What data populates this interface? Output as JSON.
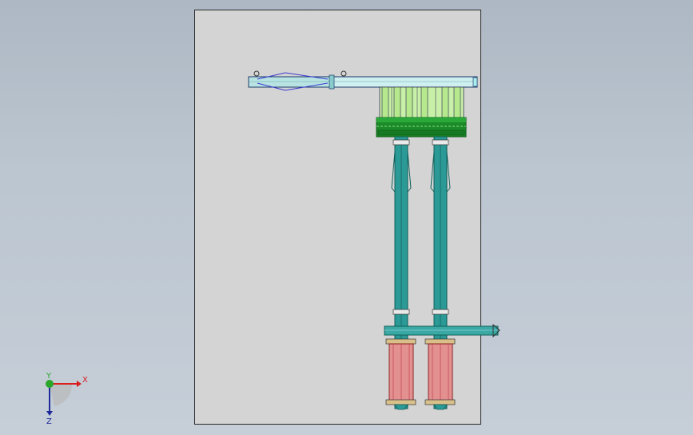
{
  "viewport": {
    "background": "#b6c0cb",
    "sheet_color": "#d4d4d4"
  },
  "model": {
    "colors": {
      "beam": "#cfeff0",
      "beam_left": "#b9e3e3",
      "outline": "#1a3a6a",
      "columns": "#c8f0a8",
      "plate": "#1d8a2a",
      "plate_dark": "#0d5a18",
      "legs": "#2b9a96",
      "legs_dark": "#0f5f5a",
      "crossbar": "#3aa9a3",
      "cylinders": "#e39090",
      "cylinders_dark": "#8a2020",
      "ropes": "#3b3bd0"
    }
  },
  "triad": {
    "x_label": "X",
    "y_label": "Y",
    "z_label": "Z",
    "x_color": "#d81e1e",
    "y_color": "#2aa62a",
    "z_color": "#1e2a9a"
  }
}
